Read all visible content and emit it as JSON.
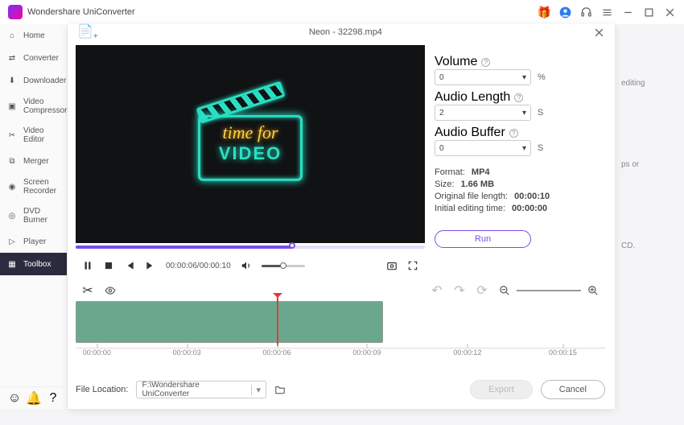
{
  "app_title": "Wondershare UniConverter",
  "titlebar_icons": {
    "gift": "gift-icon",
    "user": "user-icon",
    "headset": "headset-icon",
    "menu": "menu-icon",
    "min": "minimize-icon",
    "max": "maximize-icon",
    "close": "close-icon"
  },
  "sidebar": {
    "items": [
      {
        "label": "Home",
        "icon": "home-icon"
      },
      {
        "label": "Converter",
        "icon": "convert-icon"
      },
      {
        "label": "Downloader",
        "icon": "download-icon"
      },
      {
        "label": "Video Compressor",
        "icon": "compress-icon"
      },
      {
        "label": "Video Editor",
        "icon": "scissors-icon"
      },
      {
        "label": "Merger",
        "icon": "merge-icon"
      },
      {
        "label": "Screen Recorder",
        "icon": "record-icon"
      },
      {
        "label": "DVD Burner",
        "icon": "dvd-icon"
      },
      {
        "label": "Player",
        "icon": "play-icon"
      },
      {
        "label": "Toolbox",
        "icon": "grid-icon"
      }
    ],
    "active_index": 9,
    "bottom_icons": [
      "user-icon",
      "bell-icon",
      "help-icon"
    ]
  },
  "dialog": {
    "title": "Neon - 32298.mp4",
    "add_icon": "add-file-icon",
    "close_icon": "close-icon"
  },
  "neon": {
    "line1": "time for",
    "line2": "VIDEO"
  },
  "player": {
    "timecode": "00:00:06/00:00:10",
    "pause": "pause-icon",
    "stop": "stop-icon",
    "prev": "prev-icon",
    "next": "next-icon",
    "volume": "volume-icon",
    "snapshot": "snapshot-icon",
    "fullscreen": "fullscreen-icon"
  },
  "params": {
    "volume_label": "Volume",
    "volume_val": "0",
    "volume_unit": "%",
    "length_label": "Audio Length",
    "length_val": "2",
    "length_unit": "S",
    "buffer_label": "Audio Buffer",
    "buffer_val": "0",
    "buffer_unit": "S"
  },
  "info": {
    "format_label": "Format:",
    "format_val": "MP4",
    "size_label": "Size:",
    "size_val": "1.66 MB",
    "orig_label": "Original file length:",
    "orig_val": "00:00:10",
    "edit_label": "Initial editing time:",
    "edit_val": "00:00:00"
  },
  "run_label": "Run",
  "timeline_tools": {
    "cut": "scissors-icon",
    "eye": "eye-icon",
    "undo": "undo-icon",
    "redo": "redo-icon",
    "refresh": "refresh-icon",
    "zoom_out": "zoom-out-icon",
    "zoom_in": "zoom-in-icon"
  },
  "ruler": [
    "00:00:00",
    "00:00:03",
    "00:00:06",
    "00:00:09",
    "00:00:12",
    "00:00:15"
  ],
  "footer": {
    "loc_label": "File Location:",
    "loc_path": "F:\\Wondershare UniConverter",
    "folder": "folder-icon",
    "export_label": "Export",
    "cancel_label": "Cancel"
  },
  "bg_peek": {
    "line1": "editing",
    "line2": "ps or",
    "line3": "CD."
  }
}
